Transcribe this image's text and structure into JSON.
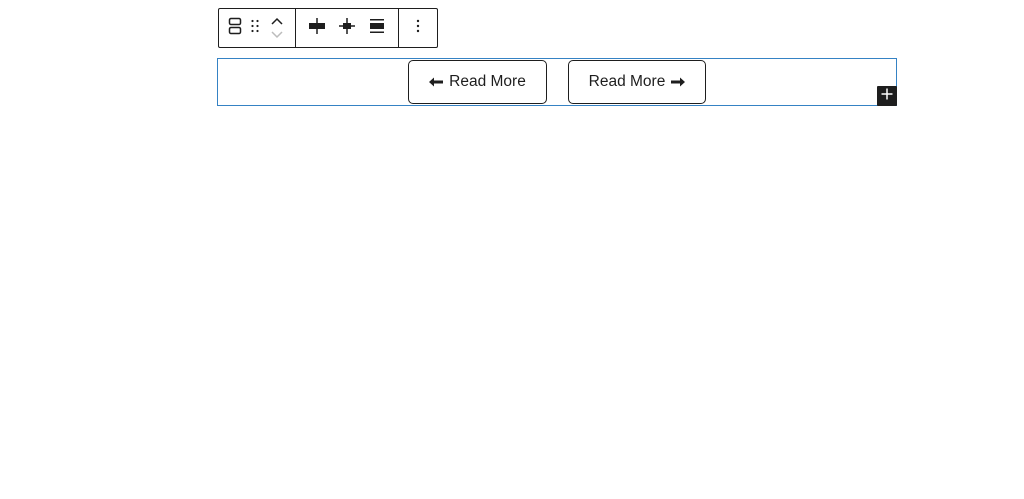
{
  "toolbar": {
    "groups": [
      {
        "items": [
          {
            "icon": "buttons-block-icon"
          },
          {
            "icon": "drag-handle-icon"
          },
          {
            "icon": "move-up-icon"
          },
          {
            "icon": "move-down-icon"
          }
        ]
      },
      {
        "items": [
          {
            "icon": "justify-center-icon"
          },
          {
            "icon": "justify-space-between-icon"
          },
          {
            "icon": "justify-stretch-icon"
          }
        ]
      },
      {
        "items": [
          {
            "icon": "more-options-icon"
          }
        ]
      }
    ]
  },
  "buttons_block": {
    "buttons": [
      {
        "label": "Read More",
        "arrow_icon": "arrow-left-icon"
      },
      {
        "label": "Read More",
        "arrow_icon": "arrow-right-icon"
      }
    ],
    "inserter_icon": "plus-icon"
  },
  "colors": {
    "selection_outline": "#3582c4",
    "text": "#1e1e1e",
    "inserter_bg": "#1e1e1e"
  }
}
